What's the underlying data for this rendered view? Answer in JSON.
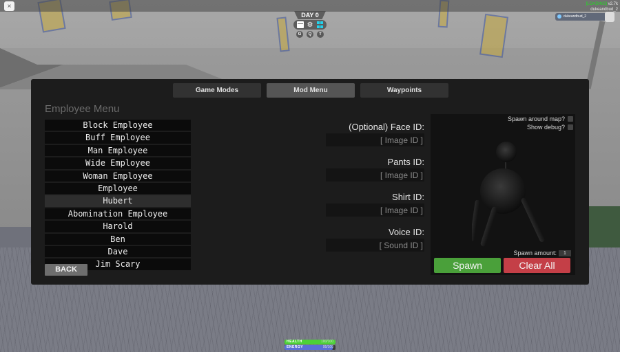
{
  "hud": {
    "close_icon": "×",
    "day_label": "DAY 0",
    "hud_keys": [
      "G",
      "Q",
      "T"
    ],
    "loading_label": "[LOADING]",
    "version": "v2.7k",
    "username": "dukeandbud_2",
    "player_chip_name": "dukeandbud_2"
  },
  "tabs": [
    {
      "label": "Game Modes",
      "active": false
    },
    {
      "label": "Mod Menu",
      "active": true
    },
    {
      "label": "Waypoints",
      "active": false
    }
  ],
  "employee_menu": {
    "title": "Employee Menu",
    "items": [
      {
        "label": "Block Employee",
        "selected": false
      },
      {
        "label": "Buff Employee",
        "selected": false
      },
      {
        "label": "Man Employee",
        "selected": false
      },
      {
        "label": "Wide Employee",
        "selected": false
      },
      {
        "label": "Woman Employee",
        "selected": false
      },
      {
        "label": "Employee",
        "selected": false
      },
      {
        "label": "Hubert",
        "selected": true
      },
      {
        "label": "Abomination Employee",
        "selected": false
      },
      {
        "label": "Harold",
        "selected": false
      },
      {
        "label": "Ben",
        "selected": false
      },
      {
        "label": "Dave",
        "selected": false
      },
      {
        "label": "Jim Scary",
        "selected": false
      }
    ],
    "back_label": "BACK"
  },
  "fields": [
    {
      "label": "(Optional) Face ID:",
      "value": "",
      "placeholder": "[ Image ID ]"
    },
    {
      "label": "Pants ID:",
      "value": "",
      "placeholder": "[ Image ID ]"
    },
    {
      "label": "Shirt ID:",
      "value": "",
      "placeholder": "[ Image ID ]"
    },
    {
      "label": "Voice ID:",
      "value": "",
      "placeholder": "[ Sound ID ]"
    }
  ],
  "preview": {
    "spawn_around_map_label": "Spawn around map?",
    "spawn_around_map_checked": false,
    "show_debug_label": "Show debug?",
    "show_debug_checked": false,
    "spawn_amount_label": "Spawn amount:",
    "spawn_amount_value": "1",
    "spawn_label": "Spawn",
    "clear_all_label": "Clear All"
  },
  "colors": {
    "spawn": "#4aa03a",
    "clear_all": "#c43f47",
    "health": "#4cd137",
    "energy": "#5b6fd6",
    "accent_cyan": "#22d3ee"
  },
  "stats": {
    "health_label": "HEALTH",
    "health_value": "100/100",
    "health_fraction": 1.0,
    "energy_label": "ENERGY",
    "energy_value": "95/100",
    "energy_fraction": 0.95
  }
}
